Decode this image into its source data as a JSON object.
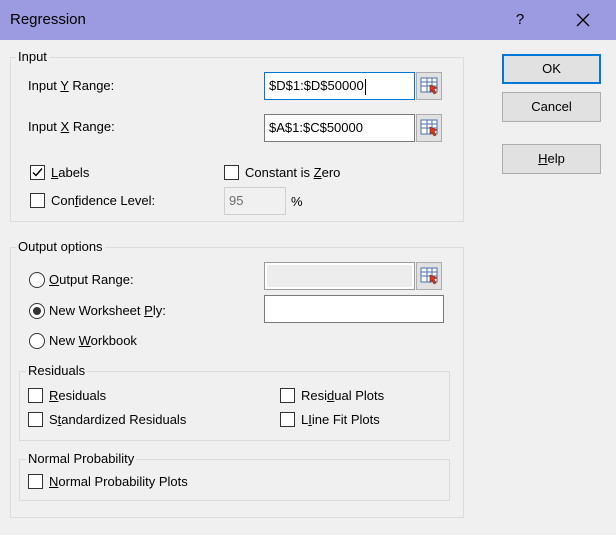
{
  "window": {
    "title": "Regression",
    "help_label": "?"
  },
  "input": {
    "legend": "Input",
    "y_range": {
      "label_pre": "Input ",
      "label_key": "Y",
      "label_post": " Range:",
      "value": "$D$1:$D$50000"
    },
    "x_range": {
      "label_pre": "Input ",
      "label_key": "X",
      "label_post": " Range:",
      "value": "$A$1:$C$50000"
    },
    "labels": {
      "label_key": "L",
      "label_rest": "abels",
      "checked": true
    },
    "constant_zero": {
      "label_pre": "Constant is ",
      "label_key": "Z",
      "label_post": "ero",
      "checked": false
    },
    "confidence": {
      "label_pre": "Con",
      "label_key": "f",
      "label_post": "idence Level:",
      "checked": false,
      "value": "95",
      "unit": "%"
    }
  },
  "output": {
    "legend": "Output options",
    "output_range": {
      "label_key": "O",
      "label_rest": "utput Range:",
      "selected": false,
      "value": ""
    },
    "new_ply": {
      "label_pre": "New Worksheet ",
      "label_key": "P",
      "label_post": "ly:",
      "selected": true,
      "value": ""
    },
    "new_workbook": {
      "label_pre": "New ",
      "label_key": "W",
      "label_post": "orkbook",
      "selected": false
    }
  },
  "residuals": {
    "legend": "Residuals",
    "residuals": {
      "label_key": "R",
      "label_rest": "esiduals",
      "checked": false
    },
    "standardized": {
      "label_pre": "S",
      "label_key": "t",
      "label_post": "andardized Residuals",
      "checked": false
    },
    "residual_plots": {
      "label_pre": "Resi",
      "label_key": "d",
      "label_post": "ual Plots",
      "checked": false
    },
    "line_fit": {
      "label_key": "I",
      "label_rest": "ine Fit Plots",
      "label_first": "L",
      "checked": false
    }
  },
  "normal": {
    "legend": "Normal Probability",
    "plots": {
      "label_key": "N",
      "label_rest": "ormal Probability Plots",
      "checked": false
    }
  },
  "buttons": {
    "ok": "OK",
    "cancel": "Cancel",
    "help_key": "H",
    "help_rest": "elp"
  },
  "colors": {
    "titlebar": "#9c9ae0",
    "focus": "#0078d7",
    "dialog_bg": "#f0f0f0"
  },
  "icons": {
    "range_picker": "range-selector-icon",
    "close": "close-icon",
    "check": "checkmark-icon"
  }
}
